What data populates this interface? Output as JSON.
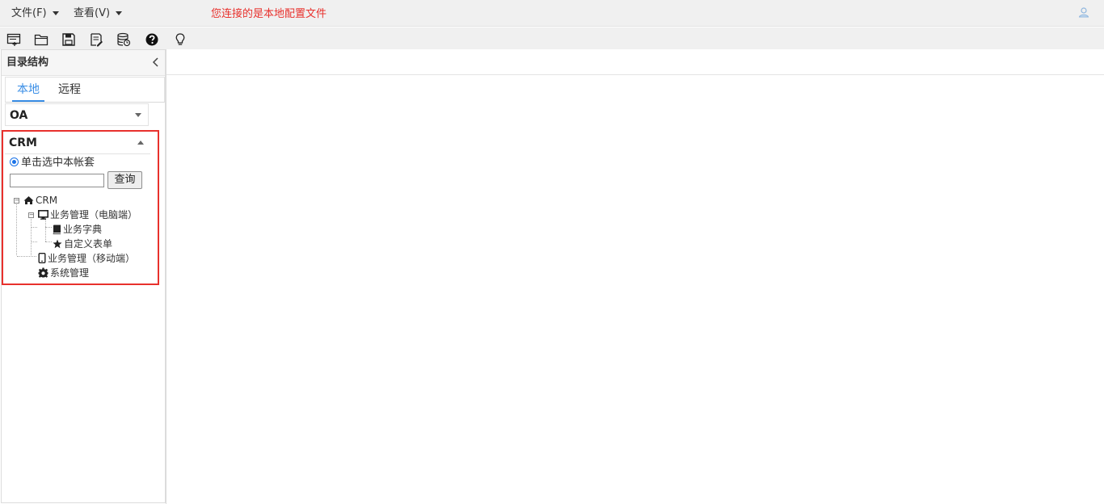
{
  "menubar": {
    "file_label": "文件(F)",
    "view_label": "查看(V)",
    "connection_message": "您连接的是本地配置文件",
    "message_color": "#e8312d"
  },
  "toolbar": {
    "icons": [
      "new-window-icon",
      "open-folder-icon",
      "save-icon",
      "edit-document-icon",
      "database-icon",
      "help-icon",
      "lightbulb-icon"
    ]
  },
  "sidebar": {
    "title": "目录结构",
    "tabs": [
      {
        "label": "本地",
        "active": true
      },
      {
        "label": "远程",
        "active": false
      }
    ],
    "accounts": [
      {
        "label": "OA",
        "expanded": false
      },
      {
        "label": "CRM",
        "expanded": true
      }
    ],
    "crm_panel": {
      "radio_label": "单击选中本帐套",
      "search_value": "",
      "query_button": "查询",
      "tree": {
        "root": "CRM",
        "nodes": [
          {
            "label": "业务管理（电脑端）",
            "icon": "desktop-icon"
          },
          {
            "label": "业务字典",
            "icon": "book-icon"
          },
          {
            "label": "自定义表单",
            "icon": "star-icon"
          },
          {
            "label": "业务管理（移动端）",
            "icon": "mobile-icon"
          },
          {
            "label": "系统管理",
            "icon": "gear-icon"
          }
        ]
      }
    },
    "highlight_color": "#e8312d"
  }
}
